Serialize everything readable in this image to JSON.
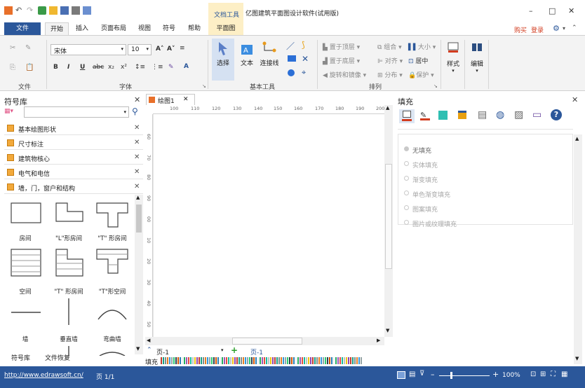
{
  "title_bar": {
    "context_tab": "文档工具",
    "app_title": "亿图建筑平面图设计软件(试用版)",
    "minimize": "–",
    "maximize": "□",
    "close": "✕"
  },
  "ribbon_tabs": {
    "file": "文件",
    "home": "开始",
    "insert": "插入",
    "page_layout": "页面布局",
    "view": "视图",
    "symbol": "符号",
    "help": "帮助",
    "floor_plan": "平面图",
    "buy": "购买",
    "login": "登录"
  },
  "ribbon": {
    "file_group": {
      "label": "文件"
    },
    "font_group": {
      "label": "字体",
      "font_name": "宋体",
      "font_size": "10",
      "bold": "B",
      "italic": "I",
      "underline": "U",
      "strike": "abc",
      "subscript": "x₂",
      "superscript": "x²",
      "grow": "A˄",
      "shrink": "A˅",
      "font_color": "A"
    },
    "basic_tools_group": {
      "label": "基本工具",
      "select": "选择",
      "text": "文本",
      "connector": "连接线"
    },
    "arrange_group": {
      "label": "排列",
      "bring_front": "置于顶层",
      "send_back": "置于底层",
      "rotate_mirror": "旋转和镜像",
      "group": "组合",
      "align": "对齐",
      "distribute": "分布",
      "size": "大小",
      "center": "居中",
      "protect": "保护"
    },
    "style": "样式",
    "edit": "编辑"
  },
  "left_panel": {
    "title": "符号库",
    "categories": [
      "基本绘图形状",
      "尺寸标注",
      "建筑物核心",
      "电气和电信",
      "墙，门，窗户和结构"
    ],
    "shapes": [
      "房间",
      "\"L\"形房间",
      "\"T\" 形房间",
      "空间",
      "\"T\" 形房间",
      "\"T\"形空间",
      "墙",
      "垂直墙",
      "弯曲墙"
    ],
    "bottom_tabs": [
      "符号库",
      "文件恢复"
    ]
  },
  "document": {
    "tab": "绘图1",
    "ruler_h": [
      "100",
      "110",
      "120",
      "130",
      "140",
      "150",
      "160",
      "170",
      "180",
      "190",
      "200"
    ],
    "ruler_v": [
      "60",
      "70",
      "80",
      "90",
      "00",
      "10",
      "20",
      "30",
      "40",
      "50"
    ],
    "page_selector": "页-1",
    "page_tab": "页-1",
    "palette_label": "填充"
  },
  "right_panel": {
    "title": "填充",
    "options": [
      {
        "label": "无填充",
        "selected": true
      },
      {
        "label": "实体填充",
        "selected": false
      },
      {
        "label": "渐变填充",
        "selected": false
      },
      {
        "label": "单色渐变填充",
        "selected": false
      },
      {
        "label": "图案填充",
        "selected": false
      },
      {
        "label": "图片或纹理填充",
        "selected": false
      }
    ]
  },
  "status_bar": {
    "url": "http://www.edrawsoft.cn/",
    "page_info": "页 1/1",
    "zoom": "100%"
  },
  "colors": {
    "accent": "#2b579a",
    "context_tab": "#fdefc6",
    "highlight": "#d23c1f"
  }
}
